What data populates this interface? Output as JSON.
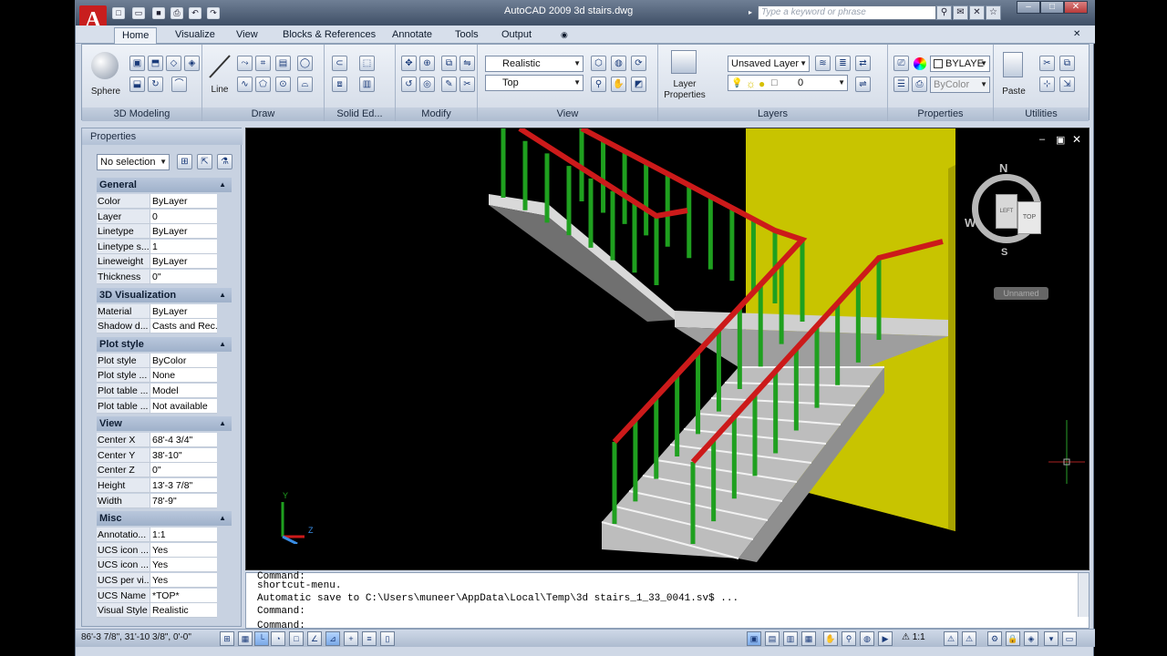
{
  "window": {
    "title": "AutoCAD 2009 3d stairs.dwg"
  },
  "search": {
    "placeholder": "Type a keyword or phrase"
  },
  "tabs": [
    "Home",
    "Visualize",
    "View",
    "Blocks & References",
    "Annotate",
    "Tools",
    "Output"
  ],
  "ribbon": {
    "modeling": {
      "big_label": "Sphere",
      "title": "3D Modeling"
    },
    "draw": {
      "big_label": "Line",
      "title": "Draw"
    },
    "solid_edit": {
      "title": "Solid Ed..."
    },
    "modify": {
      "title": "Modify"
    },
    "view": {
      "visual_style": "Realistic",
      "view_name": "Top",
      "title": "View"
    },
    "layers": {
      "big_label_1": "Layer",
      "big_label_2": "Properties",
      "layer_state": "Unsaved Layer",
      "current_layer": "0",
      "title": "Layers"
    },
    "properties": {
      "color": "BYLAYE",
      "plot_style": "ByColor",
      "title": "Properties"
    },
    "utilities": {
      "big_label": "Paste",
      "title": "Utilities"
    }
  },
  "properties_palette": {
    "title": "Properties",
    "selection": "No selection",
    "sections": [
      {
        "name": "General",
        "rows": [
          [
            "Color",
            "ByLayer"
          ],
          [
            "Layer",
            "0"
          ],
          [
            "Linetype",
            "ByLayer"
          ],
          [
            "Linetype s...",
            "1"
          ],
          [
            "Lineweight",
            "ByLayer"
          ],
          [
            "Thickness",
            "0\""
          ]
        ]
      },
      {
        "name": "3D Visualization",
        "rows": [
          [
            "Material",
            "ByLayer"
          ],
          [
            "Shadow d...",
            "Casts and Rec..."
          ]
        ]
      },
      {
        "name": "Plot style",
        "rows": [
          [
            "Plot style",
            "ByColor"
          ],
          [
            "Plot style ...",
            "None"
          ],
          [
            "Plot table ...",
            "Model"
          ],
          [
            "Plot table ...",
            "Not available"
          ]
        ]
      },
      {
        "name": "View",
        "rows": [
          [
            "Center X",
            "68'-4 3/4\""
          ],
          [
            "Center Y",
            "38'-10\""
          ],
          [
            "Center Z",
            "0\""
          ],
          [
            "Height",
            "13'-3 7/8\""
          ],
          [
            "Width",
            "78'-9\""
          ]
        ]
      },
      {
        "name": "Misc",
        "rows": [
          [
            "Annotatio...",
            "1:1"
          ],
          [
            "UCS icon ...",
            "Yes"
          ],
          [
            "UCS icon ...",
            "Yes"
          ],
          [
            "UCS per vi...",
            "Yes"
          ],
          [
            "UCS Name",
            "*TOP*"
          ],
          [
            "Visual Style",
            "Realistic"
          ]
        ]
      }
    ]
  },
  "viewcube": {
    "north": "N",
    "west": "W",
    "south": "S",
    "face_left": "LEFT",
    "face_top": "TOP",
    "ucs_menu": "Unnamed"
  },
  "ucs_icon": {
    "y": "Y",
    "z": "Z"
  },
  "command": {
    "lines": [
      "Command:",
      "shortcut-menu.",
      "Automatic save to C:\\Users\\muneer\\AppData\\Local\\Temp\\3d stairs_1_33_0041.sv$ ...",
      "Command:"
    ],
    "prompt": "Command:"
  },
  "status": {
    "coords": "86'-3 7/8\", 31'-10 3/8\", 0'-0\"",
    "scale": "1:1"
  },
  "colors": {
    "wall": "#c8c400",
    "rail": "#cc1a1a",
    "baluster": "#1fa01f",
    "stair": "#c7c7c7"
  }
}
